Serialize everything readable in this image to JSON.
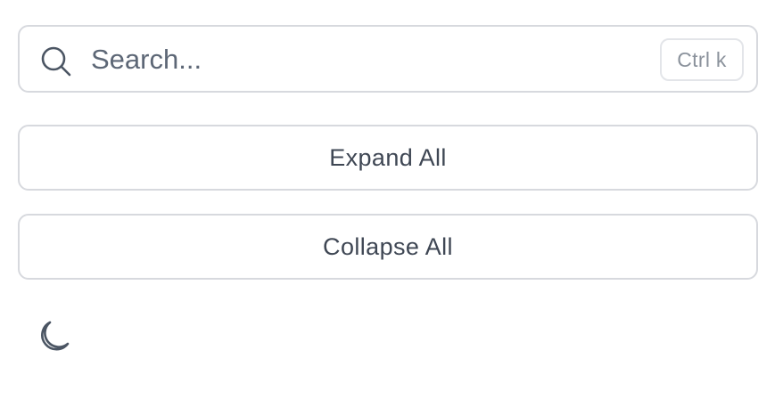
{
  "search": {
    "placeholder": "Search...",
    "value": "",
    "icon": "search-icon",
    "shortcut_label": "Ctrl k"
  },
  "actions": {
    "expand_all_label": "Expand All",
    "collapse_all_label": "Collapse All"
  },
  "theme": {
    "icon": "moon-icon"
  },
  "colors": {
    "border": "#d7d9de",
    "text": "#3f4754",
    "placeholder": "#5d6776",
    "shortcut_text": "#8b929c",
    "icon": "#4b5563",
    "background": "#ffffff"
  }
}
